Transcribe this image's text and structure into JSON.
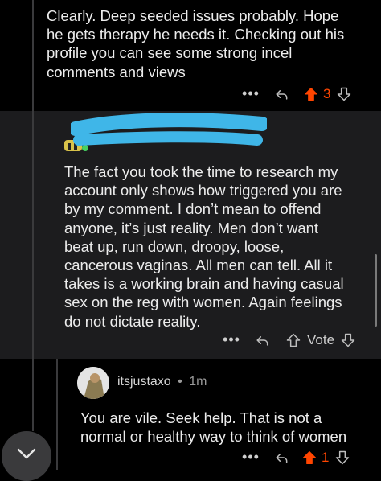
{
  "comments": [
    {
      "body": "Clearly. Deep seeded issues probably. Hope\nhe gets therapy he needs it. Checking out his\nprofile you can see some strong incel\ncomments and views",
      "score": "3",
      "upvoted": true
    },
    {
      "body": "The fact you took the time to research my\naccount only shows how triggered you are\nby my comment. I don’t mean to offend\nanyone, it’s just reality. Men don’t want\nbeat up, run down, droopy, loose,\ncancerous vaginas. All men can tell. All it\ntakes is a working brain and having casual\nsex on the reg with women. Again feelings\ndo not dictate reality.",
      "vote_label": "Vote",
      "upvoted": false
    },
    {
      "username": "itsjustaxo",
      "separator": "•",
      "time": "1m",
      "body": "You are vile. Seek help. That is not a\nnormal or healthy way to think of women",
      "score": "1",
      "upvoted": true
    }
  ],
  "icons": {
    "more": "more-options-icon",
    "reply": "reply-icon",
    "upvote": "upvote-arrow-icon",
    "downvote": "downvote-arrow-icon",
    "scroll": "chevron-down-icon"
  },
  "colors": {
    "upvote_active": "#ff4500",
    "redaction": "#3fb6e8",
    "highlight_bg": "#1c1c1e"
  }
}
